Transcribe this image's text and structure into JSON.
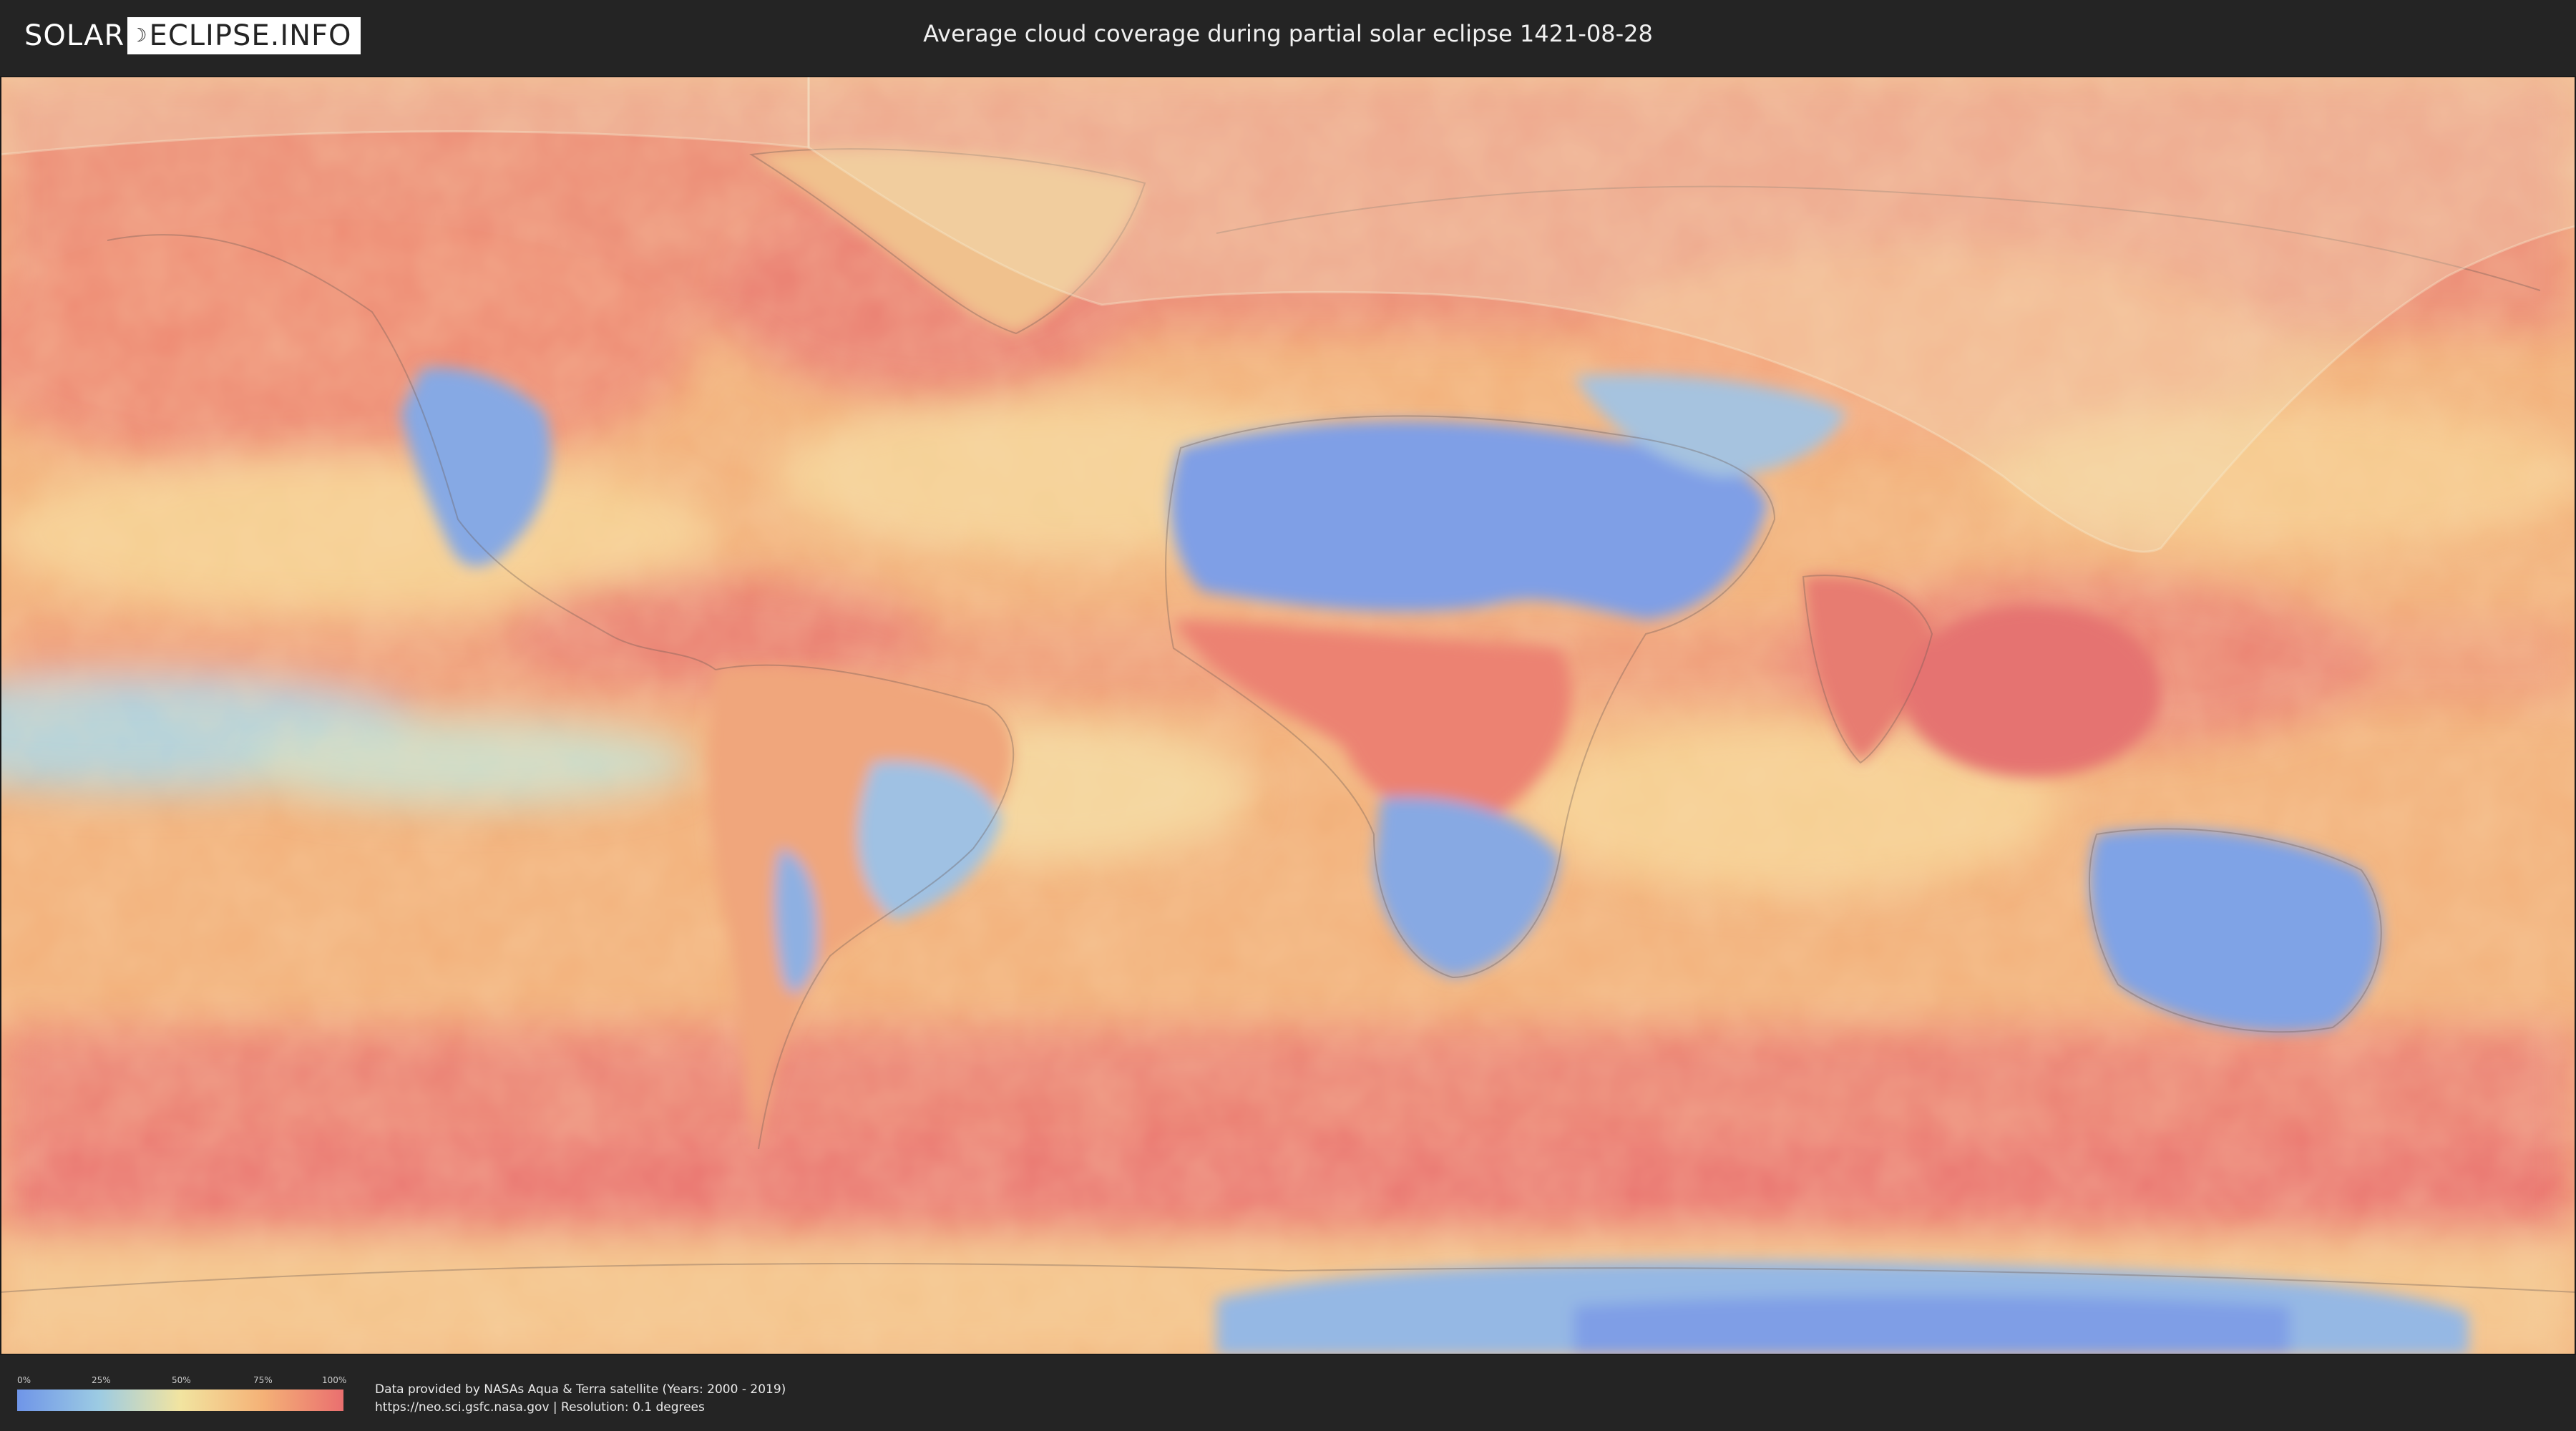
{
  "header": {
    "logo_left": "SOLAR",
    "logo_right": "ECLIPSE.INFO",
    "title": "Average cloud coverage during partial solar eclipse 1421-08-28"
  },
  "map": {
    "type": "world cloud coverage map with eclipse visibility overlay"
  },
  "legend": {
    "labels": [
      "0%",
      "25%",
      "50%",
      "75%",
      "100%"
    ],
    "colors": [
      "#6f95e8",
      "#9ccbe3",
      "#f2e4a0",
      "#f4b277",
      "#ea6f6f"
    ]
  },
  "footer": {
    "credit_line1": "Data provided by NASAs Aqua & Terra satellite (Years: 2000 - 2019)",
    "credit_line2": "https://neo.sci.gsfc.nasa.gov | Resolution: 0.1 degrees"
  },
  "colors": {
    "background": "#242424",
    "ocean_cloudy": "#ea6f6f",
    "clear_desert": "#6f95e8"
  }
}
